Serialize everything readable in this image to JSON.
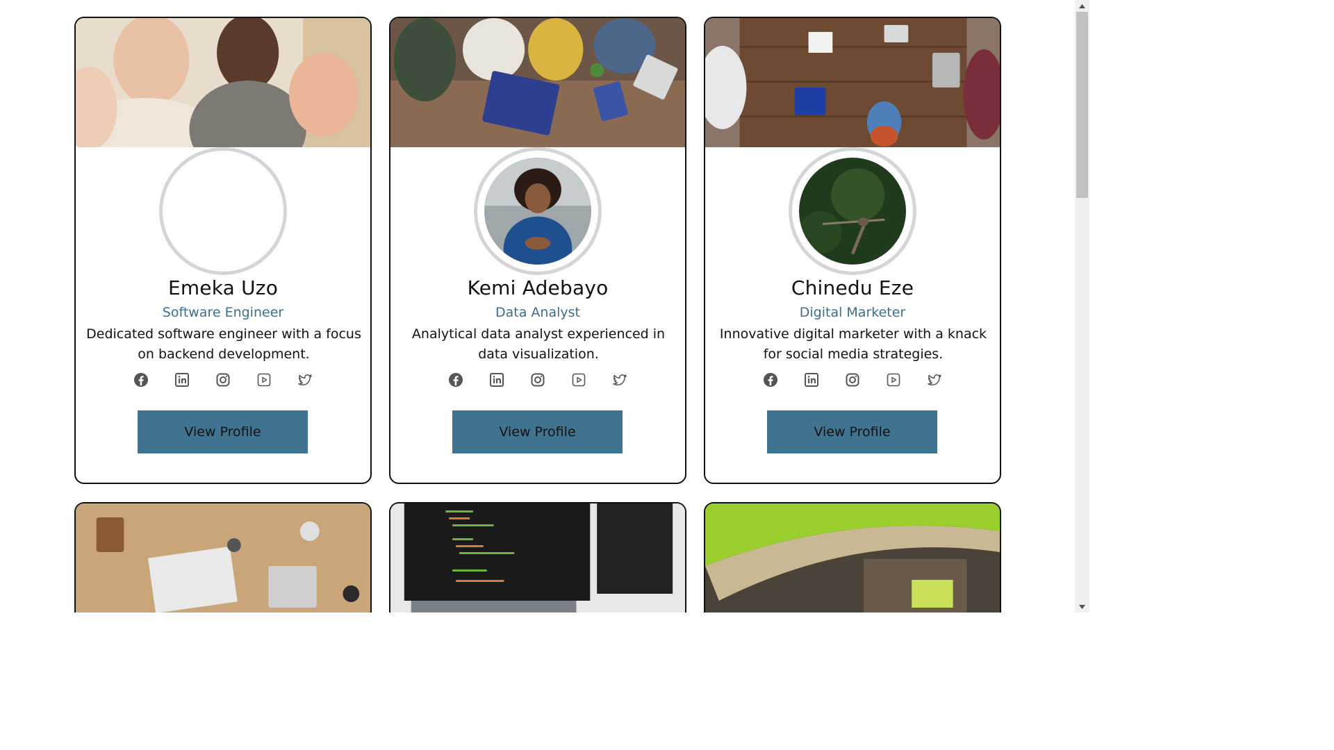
{
  "cards": [
    {
      "name": "Emeka Uzo",
      "role": "Software Engineer",
      "bio": "Dedicated software engineer with a focus on backend development.",
      "button": "View Profile",
      "banner": "team-meeting-photo",
      "avatar": "blank"
    },
    {
      "name": "Kemi Adebayo",
      "role": "Data Analyst",
      "bio": "Analytical data analyst experienced in data visualization.",
      "button": "View Profile",
      "banner": "laptop-meeting-photo",
      "avatar": "woman-portrait-photo"
    },
    {
      "name": "Chinedu Eze",
      "role": "Digital Marketer",
      "bio": "Innovative digital marketer with a knack for social media strategies.",
      "button": "View Profile",
      "banner": "overhead-table-photo",
      "avatar": "dragonfly-photo"
    }
  ],
  "partial_cards": [
    {
      "banner": "desk-charts-photo"
    },
    {
      "banner": "code-monitor-photo"
    },
    {
      "banner": "atrium-building-photo"
    }
  ],
  "social_icons": [
    "facebook-icon",
    "linkedin-icon",
    "instagram-icon",
    "youtube-icon",
    "twitter-icon"
  ],
  "colors": {
    "accent": "#3f738f",
    "role_text": "#3d6f8e",
    "card_border": "#111111",
    "avatar_ring": "#d5d5d5",
    "icon": "#555555"
  }
}
